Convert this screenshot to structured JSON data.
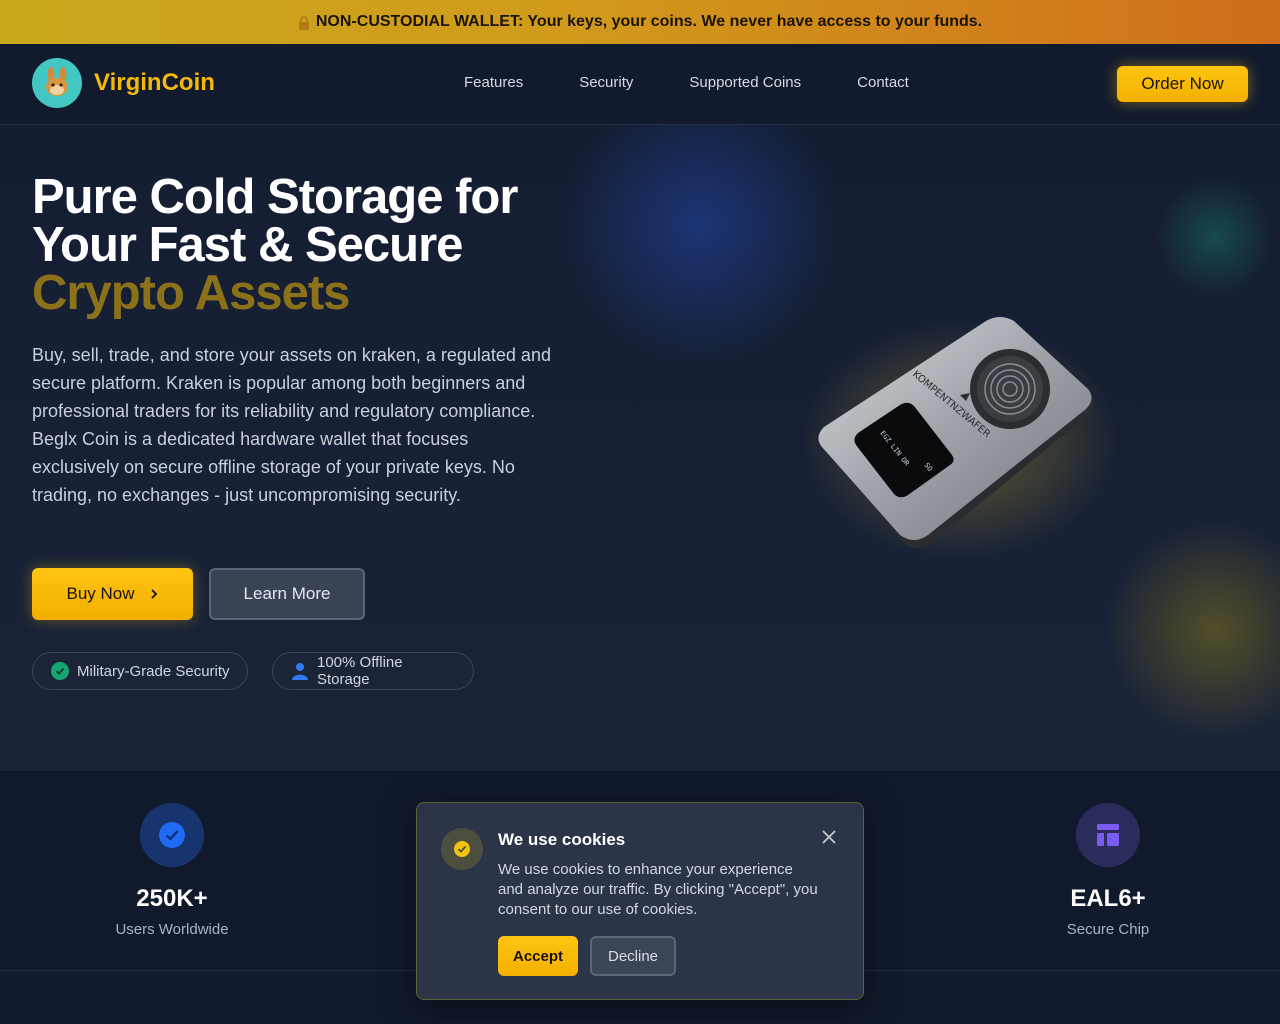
{
  "banner": {
    "text": "NON-CUSTODIAL WALLET: Your keys, your coins. We never have access to your funds.",
    "icon": "lock-icon"
  },
  "header": {
    "brand": "VirginCoin",
    "logo_icon": "bunny-icon",
    "nav": [
      "Features",
      "Security",
      "Supported Coins",
      "Contact"
    ],
    "cta": "Order Now"
  },
  "hero": {
    "title_line1": "Pure Cold Storage for",
    "title_line2": "Your Fast & Secure",
    "title_highlight": "Crypto Assets",
    "description": "Buy, sell, trade, and store your assets on kraken, a regulated and secure platform. Kraken is popular among both beginners and professional traders for its reliability and regulatory compliance. Beglx Coin is a dedicated hardware wallet that focuses exclusively on secure offline storage of your private keys. No trading, no exchanges - just uncompromising security.",
    "buy_label": "Buy Now",
    "learn_label": "Learn More",
    "badges": [
      {
        "label": "Military-Grade Security",
        "icon": "check-shield-icon"
      },
      {
        "label": "100% Offline Storage",
        "icon": "user-icon"
      }
    ],
    "device_label": "KOMPENTNZWAFER"
  },
  "stats": [
    {
      "value": "250K+",
      "label": "Users Worldwide",
      "icon": "check-icon"
    },
    {
      "value": "EAL6+",
      "label": "Secure Chip",
      "icon": "chip-icon"
    }
  ],
  "cookie": {
    "title": "We use cookies",
    "message": "We use cookies to enhance your experience and analyze our traffic. By clicking \"Accept\", you consent to our use of cookies.",
    "accept": "Accept",
    "decline": "Decline"
  },
  "colors": {
    "accent": "#f5b000",
    "banner_start": "#c9a91c",
    "banner_end": "#cf6e1b",
    "background": "#111a2c"
  }
}
